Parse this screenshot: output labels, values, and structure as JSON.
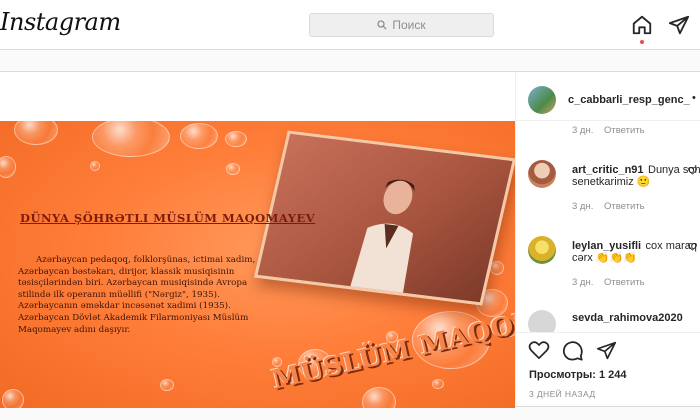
{
  "header": {
    "logo": "Instagram",
    "search_placeholder": "Поиск"
  },
  "post": {
    "author": "c_cabbarli_resp_genc_",
    "author_more": "•",
    "image": {
      "heading": "DÜNYA ŞÖHRƏTLI MÜSLÜM MAQOMAYEV",
      "body": "Azərbaycan pedaqoq, folklorşünas, ictimai xadim, Azərbaycan bəstəkarı, dirijor, klassik musiqisinin təsisçilərindən biri. Azərbaycan musiqisində Avropa stilində ilk operanın müəllifi (\"Nərgiz\", 1935). Azərbaycanın əməkdar incəsənət xadimi (1935). Azərbaycan Dövlət Akademik Filarmoniyası Müslüm Maqomayev adını daşıyır.",
      "photo_caption": "MÜSLÜM MAQOMAYEV"
    },
    "comments": [
      {
        "time": "3 дн.",
        "reply": "Ответить"
      },
      {
        "user": "art_critic_n91",
        "text": "Dunya soh",
        "text2": "senetkarimiz 🙂",
        "time": "3 дн.",
        "reply": "Ответить"
      },
      {
        "user": "leylan_yusifli",
        "text": "cox maraq",
        "text2": "cərx 👏👏👏",
        "time": "3 дн.",
        "reply": "Ответить"
      },
      {
        "user": "sevda_rahimova2020",
        "text": ""
      }
    ],
    "likes": "Просмотры: 1 244",
    "date": "3 ДНЕЙ НАЗАД"
  }
}
